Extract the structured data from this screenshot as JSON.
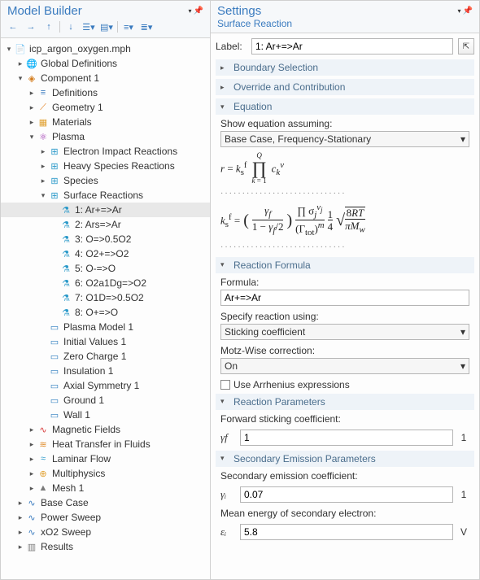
{
  "left": {
    "title": "Model Builder",
    "tree": [
      {
        "d": 0,
        "exp": "▾",
        "icon": "📄",
        "cls": "",
        "label": "icp_argon_oxygen.mph"
      },
      {
        "d": 1,
        "exp": "▸",
        "icon": "🌐",
        "cls": "i-globe",
        "label": "Global Definitions"
      },
      {
        "d": 1,
        "exp": "▾",
        "icon": "◈",
        "cls": "i-comp",
        "label": "Component 1"
      },
      {
        "d": 2,
        "exp": "▸",
        "icon": "≡",
        "cls": "i-def",
        "label": "Definitions"
      },
      {
        "d": 2,
        "exp": "▸",
        "icon": "⟋",
        "cls": "i-geom",
        "label": "Geometry 1"
      },
      {
        "d": 2,
        "exp": "▸",
        "icon": "▦",
        "cls": "i-mat",
        "label": "Materials"
      },
      {
        "d": 2,
        "exp": "▾",
        "icon": "⚛",
        "cls": "i-plasma",
        "label": "Plasma"
      },
      {
        "d": 3,
        "exp": "▸",
        "icon": "⊞",
        "cls": "i-react",
        "label": "Electron Impact Reactions"
      },
      {
        "d": 3,
        "exp": "▸",
        "icon": "⊞",
        "cls": "i-react",
        "label": "Heavy Species Reactions"
      },
      {
        "d": 3,
        "exp": "▸",
        "icon": "⊞",
        "cls": "i-react",
        "label": "Species"
      },
      {
        "d": 3,
        "exp": "▾",
        "icon": "⊞",
        "cls": "i-react",
        "label": "Surface Reactions"
      },
      {
        "d": 4,
        "exp": "",
        "icon": "⚗",
        "cls": "i-flask",
        "label": "1: Ar+=>Ar",
        "sel": true
      },
      {
        "d": 4,
        "exp": "",
        "icon": "⚗",
        "cls": "i-flask",
        "label": "2: Ars=>Ar"
      },
      {
        "d": 4,
        "exp": "",
        "icon": "⚗",
        "cls": "i-flask",
        "label": "3: O=>0.5O2"
      },
      {
        "d": 4,
        "exp": "",
        "icon": "⚗",
        "cls": "i-flask",
        "label": "4: O2+=>O2"
      },
      {
        "d": 4,
        "exp": "",
        "icon": "⚗",
        "cls": "i-flask",
        "label": "5: O-=>O"
      },
      {
        "d": 4,
        "exp": "",
        "icon": "⚗",
        "cls": "i-flask",
        "label": "6: O2a1Dg=>O2"
      },
      {
        "d": 4,
        "exp": "",
        "icon": "⚗",
        "cls": "i-flask",
        "label": "7: O1D=>0.5O2"
      },
      {
        "d": 4,
        "exp": "",
        "icon": "⚗",
        "cls": "i-flask",
        "label": "8: O+=>O"
      },
      {
        "d": 3,
        "exp": "",
        "icon": "▭",
        "cls": "i-model",
        "label": "Plasma Model 1"
      },
      {
        "d": 3,
        "exp": "",
        "icon": "▭",
        "cls": "i-bc",
        "label": "Initial Values 1"
      },
      {
        "d": 3,
        "exp": "",
        "icon": "▭",
        "cls": "i-bc",
        "label": "Zero Charge 1"
      },
      {
        "d": 3,
        "exp": "",
        "icon": "▭",
        "cls": "i-bc",
        "label": "Insulation 1"
      },
      {
        "d": 3,
        "exp": "",
        "icon": "▭",
        "cls": "i-bc",
        "label": "Axial Symmetry 1"
      },
      {
        "d": 3,
        "exp": "",
        "icon": "▭",
        "cls": "i-bc",
        "label": "Ground 1"
      },
      {
        "d": 3,
        "exp": "",
        "icon": "▭",
        "cls": "i-bc",
        "label": "Wall 1"
      },
      {
        "d": 2,
        "exp": "▸",
        "icon": "∿",
        "cls": "i-mag",
        "label": "Magnetic Fields"
      },
      {
        "d": 2,
        "exp": "▸",
        "icon": "≋",
        "cls": "i-heat",
        "label": "Heat Transfer in Fluids"
      },
      {
        "d": 2,
        "exp": "▸",
        "icon": "≈",
        "cls": "i-flow",
        "label": "Laminar Flow"
      },
      {
        "d": 2,
        "exp": "▸",
        "icon": "⊕",
        "cls": "i-multi",
        "label": "Multiphysics"
      },
      {
        "d": 2,
        "exp": "▸",
        "icon": "▲",
        "cls": "i-mesh",
        "label": "Mesh 1"
      },
      {
        "d": 1,
        "exp": "▸",
        "icon": "∿",
        "cls": "i-study",
        "label": "Base Case"
      },
      {
        "d": 1,
        "exp": "▸",
        "icon": "∿",
        "cls": "i-study",
        "label": "Power Sweep"
      },
      {
        "d": 1,
        "exp": "▸",
        "icon": "∿",
        "cls": "i-study",
        "label": "xO2 Sweep"
      },
      {
        "d": 1,
        "exp": "▸",
        "icon": "▥",
        "cls": "i-res",
        "label": "Results"
      }
    ]
  },
  "right": {
    "title": "Settings",
    "subtitle": "Surface Reaction",
    "label_text": "Label:",
    "label_value": "1: Ar+=>Ar",
    "sections": {
      "boundary": {
        "title": "Boundary Selection"
      },
      "override": {
        "title": "Override and Contribution"
      },
      "equation": {
        "title": "Equation",
        "show_label": "Show equation assuming:",
        "show_value": "Base Case, Frequency-Stationary",
        "eq1": "r = kₛᶠ ∏ cₖᵛ   (k = 1 … Q)",
        "eq2": "kₛᶠ = ( γf / (1 − γf /2) ) · ( ∏ σⱼᵛʲ / (Γtot)ᵐ ) · (1/4) · √(8RT / πMw)"
      },
      "formula": {
        "title": "Reaction Formula",
        "formula_label": "Formula:",
        "formula_value": "Ar+=>Ar",
        "spec_label": "Specify reaction using:",
        "spec_value": "Sticking coefficient",
        "motz_label": "Motz-Wise correction:",
        "motz_value": "On",
        "arrhenius": "Use Arrhenius expressions"
      },
      "params": {
        "title": "Reaction Parameters",
        "fwd_label": "Forward sticking coefficient:",
        "gamma_f": "γf",
        "gamma_f_val": "1",
        "gamma_f_unit": "1"
      },
      "secondary": {
        "title": "Secondary Emission Parameters",
        "sec_label": "Secondary emission coefficient:",
        "gamma_i": "γᵢ",
        "gamma_i_val": "0.07",
        "gamma_i_unit": "1",
        "energy_label": "Mean energy of secondary electron:",
        "eps_i": "εᵢ",
        "eps_i_val": "5.8",
        "eps_i_unit": "V"
      }
    }
  }
}
